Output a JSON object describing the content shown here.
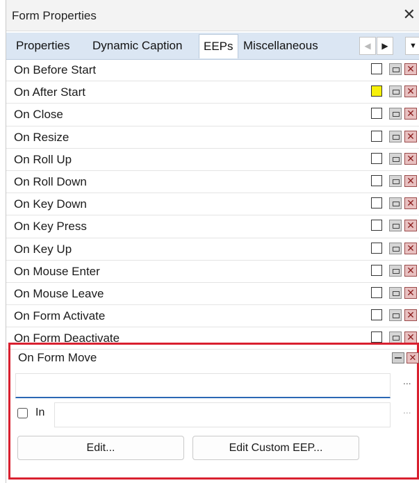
{
  "window": {
    "title": "Form Properties",
    "close_glyph": "✕"
  },
  "tabs": [
    {
      "label": "Properties"
    },
    {
      "label": "Dynamic Caption"
    },
    {
      "label": "EEPs",
      "active": true
    },
    {
      "label": "Miscellaneous"
    }
  ],
  "tab_scroll": {
    "left_glyph": "◀",
    "right_glyph": "▶",
    "menu_glyph": "▼"
  },
  "events": [
    {
      "label": "On Before Start",
      "checked": false
    },
    {
      "label": "On After Start",
      "checked": false,
      "color": "#f7f00a"
    },
    {
      "label": "On Close",
      "checked": false
    },
    {
      "label": "On Resize",
      "checked": false
    },
    {
      "label": "On Roll Up",
      "checked": false
    },
    {
      "label": "On Roll Down",
      "checked": false
    },
    {
      "label": "On Key Down",
      "checked": false
    },
    {
      "label": "On Key Press",
      "checked": false
    },
    {
      "label": "On Key Up",
      "checked": false
    },
    {
      "label": "On Mouse Enter",
      "checked": false
    },
    {
      "label": "On Mouse Leave",
      "checked": false
    },
    {
      "label": "On Form Activate",
      "checked": false
    },
    {
      "label": "On Form Deactivate",
      "checked": false
    }
  ],
  "selected_event": {
    "label": "On Form Move",
    "eep_value": "",
    "dots": "...",
    "in_label": "In",
    "in_checked": false,
    "in_value": "",
    "edit_label": "Edit...",
    "edit_custom_label": "Edit Custom EEP..."
  },
  "colors": {
    "highlight": "#d9202f",
    "tabbar": "#dbe6f3",
    "focus": "#2a67b4"
  }
}
